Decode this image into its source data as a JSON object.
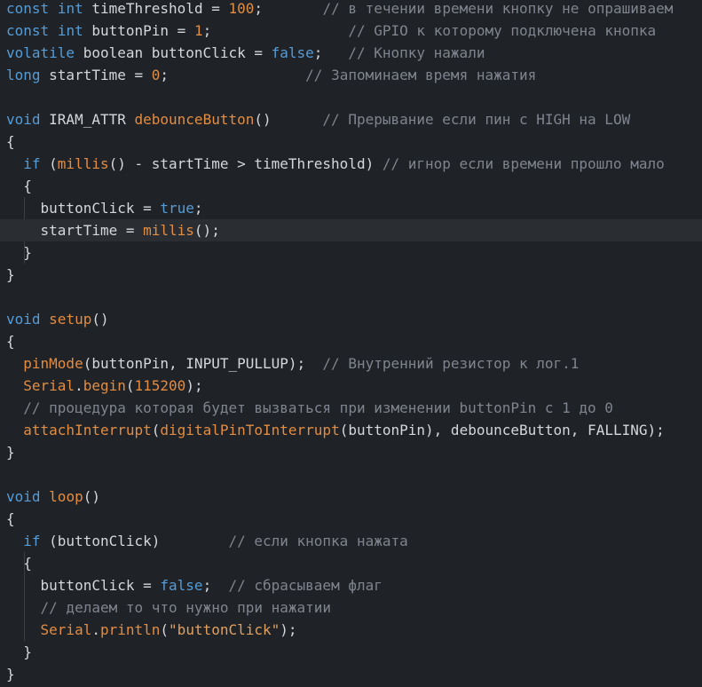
{
  "editor": {
    "lines": [
      [
        {
          "t": "const",
          "c": "kw"
        },
        {
          "t": " ",
          "c": "pl"
        },
        {
          "t": "int",
          "c": "kw"
        },
        {
          "t": " timeThreshold = ",
          "c": "pl"
        },
        {
          "t": "100",
          "c": "num"
        },
        {
          "t": ";       ",
          "c": "pl"
        },
        {
          "t": "// в течении времени кнопку не опрашиваем",
          "c": "cm"
        }
      ],
      [
        {
          "t": "const",
          "c": "kw"
        },
        {
          "t": " ",
          "c": "pl"
        },
        {
          "t": "int",
          "c": "kw"
        },
        {
          "t": " buttonPin = ",
          "c": "pl"
        },
        {
          "t": "1",
          "c": "num"
        },
        {
          "t": ";                ",
          "c": "pl"
        },
        {
          "t": "// GPIO к которому подключена кнопка",
          "c": "cm"
        }
      ],
      [
        {
          "t": "volatile",
          "c": "kw"
        },
        {
          "t": " boolean buttonClick = ",
          "c": "pl"
        },
        {
          "t": "false",
          "c": "kw"
        },
        {
          "t": ";   ",
          "c": "pl"
        },
        {
          "t": "// Кнопку нажали",
          "c": "cm"
        }
      ],
      [
        {
          "t": "long",
          "c": "kw"
        },
        {
          "t": " startTime = ",
          "c": "pl"
        },
        {
          "t": "0",
          "c": "num"
        },
        {
          "t": ";                ",
          "c": "pl"
        },
        {
          "t": "// Запоминаем время нажатия",
          "c": "cm"
        }
      ],
      [],
      [
        {
          "t": "void",
          "c": "kw"
        },
        {
          "t": " IRAM_ATTR ",
          "c": "pl"
        },
        {
          "t": "debounceButton",
          "c": "fn"
        },
        {
          "t": "()      ",
          "c": "pl"
        },
        {
          "t": "// Прерывание если пин с HIGH на LOW",
          "c": "cm"
        }
      ],
      [
        {
          "t": "{",
          "c": "pl"
        }
      ],
      [
        {
          "t": "  ",
          "c": "pl"
        },
        {
          "t": "if",
          "c": "kw"
        },
        {
          "t": " (",
          "c": "pl"
        },
        {
          "t": "millis",
          "c": "fn"
        },
        {
          "t": "() - startTime > timeThreshold) ",
          "c": "pl"
        },
        {
          "t": "// игнор если времени прошло мало",
          "c": "cm"
        }
      ],
      [
        {
          "t": "  {",
          "c": "pl"
        }
      ],
      [
        {
          "t": "    buttonClick = ",
          "c": "pl"
        },
        {
          "t": "true",
          "c": "kw"
        },
        {
          "t": ";",
          "c": "pl"
        }
      ],
      [
        {
          "t": "    startTime = ",
          "c": "pl"
        },
        {
          "t": "millis",
          "c": "fn"
        },
        {
          "t": "();",
          "c": "pl"
        }
      ],
      [
        {
          "t": "  }",
          "c": "pl"
        }
      ],
      [
        {
          "t": "}",
          "c": "pl"
        }
      ],
      [],
      [
        {
          "t": "void",
          "c": "kw"
        },
        {
          "t": " ",
          "c": "pl"
        },
        {
          "t": "setup",
          "c": "fn"
        },
        {
          "t": "()",
          "c": "pl"
        }
      ],
      [
        {
          "t": "{",
          "c": "pl"
        }
      ],
      [
        {
          "t": "  ",
          "c": "pl"
        },
        {
          "t": "pinMode",
          "c": "fn"
        },
        {
          "t": "(buttonPin, INPUT_PULLUP);  ",
          "c": "pl"
        },
        {
          "t": "// Внутренний резистор к лог.1",
          "c": "cm"
        }
      ],
      [
        {
          "t": "  ",
          "c": "pl"
        },
        {
          "t": "Serial",
          "c": "fn"
        },
        {
          "t": ".",
          "c": "pl"
        },
        {
          "t": "begin",
          "c": "fn"
        },
        {
          "t": "(",
          "c": "pl"
        },
        {
          "t": "115200",
          "c": "num"
        },
        {
          "t": ");",
          "c": "pl"
        }
      ],
      [
        {
          "t": "  ",
          "c": "pl"
        },
        {
          "t": "// процедура которая будет вызваться при изменении buttonPin с 1 до 0",
          "c": "cm"
        }
      ],
      [
        {
          "t": "  ",
          "c": "pl"
        },
        {
          "t": "attachInterrupt",
          "c": "fn"
        },
        {
          "t": "(",
          "c": "pl"
        },
        {
          "t": "digitalPinToInterrupt",
          "c": "fn"
        },
        {
          "t": "(buttonPin), debounceButton, FALLING);",
          "c": "pl"
        }
      ],
      [
        {
          "t": "}",
          "c": "pl"
        }
      ],
      [],
      [
        {
          "t": "void",
          "c": "kw"
        },
        {
          "t": " ",
          "c": "pl"
        },
        {
          "t": "loop",
          "c": "fn"
        },
        {
          "t": "()",
          "c": "pl"
        }
      ],
      [
        {
          "t": "{",
          "c": "pl"
        }
      ],
      [
        {
          "t": "  ",
          "c": "pl"
        },
        {
          "t": "if",
          "c": "kw"
        },
        {
          "t": " (buttonClick)        ",
          "c": "pl"
        },
        {
          "t": "// если кнопка нажата",
          "c": "cm"
        }
      ],
      [
        {
          "t": "  {",
          "c": "pl"
        }
      ],
      [
        {
          "t": "    buttonClick = ",
          "c": "pl"
        },
        {
          "t": "false",
          "c": "kw"
        },
        {
          "t": ";  ",
          "c": "pl"
        },
        {
          "t": "// сбрасываем флаг",
          "c": "cm"
        }
      ],
      [
        {
          "t": "    ",
          "c": "pl"
        },
        {
          "t": "// делаем то что нужно при нажатии",
          "c": "cm"
        }
      ],
      [
        {
          "t": "    ",
          "c": "pl"
        },
        {
          "t": "Serial",
          "c": "fn"
        },
        {
          "t": ".",
          "c": "pl"
        },
        {
          "t": "println",
          "c": "fn"
        },
        {
          "t": "(",
          "c": "pl"
        },
        {
          "t": "\"buttonClick\"",
          "c": "str"
        },
        {
          "t": ");",
          "c": "pl"
        }
      ],
      [
        {
          "t": "  }",
          "c": "pl"
        }
      ],
      [
        {
          "t": "}",
          "c": "pl"
        }
      ]
    ],
    "active_line": 10,
    "colors": {
      "background": "#1f2226",
      "keyword": "#569cd6",
      "function": "#e28d42",
      "comment": "#7f848e",
      "plain": "#d4d7db"
    }
  }
}
